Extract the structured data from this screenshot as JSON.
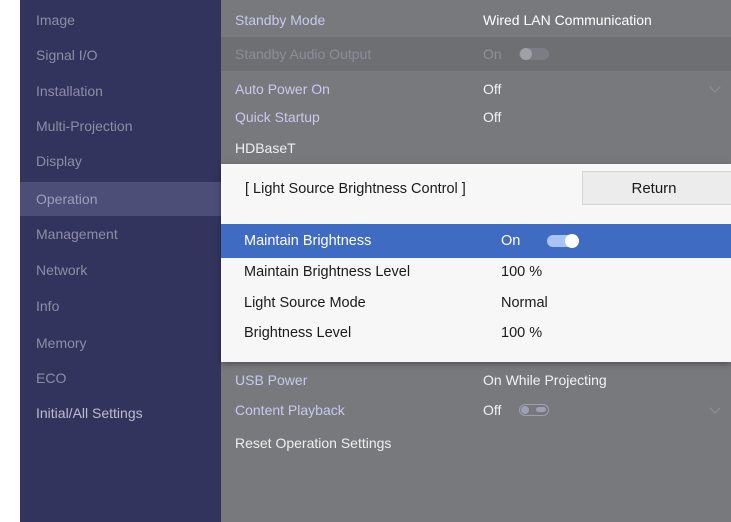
{
  "sidebar": {
    "items": [
      {
        "label": "Image"
      },
      {
        "label": "Signal I/O"
      },
      {
        "label": "Installation"
      },
      {
        "label": "Multi-Projection"
      },
      {
        "label": "Display"
      },
      {
        "label": "Operation",
        "selected": true
      },
      {
        "label": "Management"
      },
      {
        "label": "Network"
      },
      {
        "label": "Info"
      },
      {
        "label": "Memory"
      },
      {
        "label": "ECO"
      },
      {
        "label": "Initial/All Settings"
      }
    ]
  },
  "settings": {
    "standby_mode": {
      "label": "Standby Mode",
      "value": "Wired LAN Communication"
    },
    "standby_audio_output": {
      "label": "Standby Audio Output",
      "value": "On",
      "enabled": false
    },
    "auto_power_on": {
      "label": "Auto Power On",
      "value": "Off"
    },
    "quick_startup": {
      "label": "Quick Startup",
      "value": "Off"
    },
    "hdbaset": {
      "label": "HDBaseT"
    },
    "usb_power": {
      "label": "USB Power",
      "value": "On While Projecting"
    },
    "content_playback": {
      "label": "Content Playback",
      "value": "Off",
      "toggle_on": false
    },
    "reset_operation": {
      "label": "Reset Operation Settings"
    }
  },
  "dialog": {
    "title": "[ Light Source Brightness Control ]",
    "return_label": "Return",
    "rows": [
      {
        "label": "Maintain Brightness",
        "value": "On",
        "toggle_on": true,
        "highlighted": true
      },
      {
        "label": "Maintain Brightness Level",
        "value": "100 %"
      },
      {
        "label": "Light Source Mode",
        "value": "Normal"
      },
      {
        "label": "Brightness Level",
        "value": "100 %"
      }
    ]
  },
  "colors": {
    "sidebar_bg": "#33345d",
    "sidebar_selected": "#4c4e77",
    "highlight": "#3f6cc2",
    "dialog_bg": "#f7f7f7"
  }
}
